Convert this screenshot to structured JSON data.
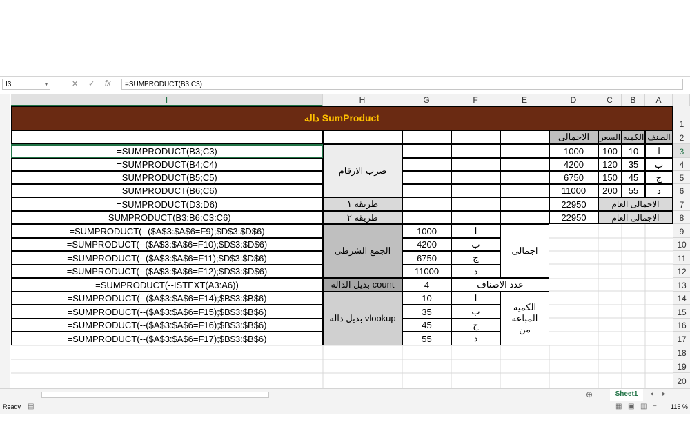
{
  "formula_bar": {
    "name_box": "I3",
    "formula": "=SUMPRODUCT(B3;C3)",
    "cancel": "✕",
    "enter": "✓",
    "fx": "fx"
  },
  "columns": [
    "I",
    "H",
    "G",
    "F",
    "E",
    "D",
    "C",
    "B",
    "A"
  ],
  "rows": [
    "1",
    "2",
    "3",
    "4",
    "5",
    "6",
    "7",
    "8",
    "9",
    "10",
    "11",
    "12",
    "13",
    "14",
    "15",
    "16",
    "17",
    "18",
    "19",
    "20"
  ],
  "title": "داله SumProduct",
  "table": {
    "headers": {
      "item": "الصنف",
      "qty": "الكميه",
      "price": "السعر",
      "total": "الاجمالى"
    },
    "rows": [
      {
        "item": "ا",
        "qty": "10",
        "price": "100",
        "total": "1000"
      },
      {
        "item": "ب",
        "qty": "35",
        "price": "120",
        "total": "4200"
      },
      {
        "item": "ج",
        "qty": "45",
        "price": "150",
        "total": "6750"
      },
      {
        "item": "د",
        "qty": "55",
        "price": "200",
        "total": "11000"
      }
    ],
    "grand_label": "الاجمالى العام",
    "grand_1": "22950",
    "grand_2": "22950"
  },
  "formulas": {
    "r3": "=SUMPRODUCT(B3;C3)",
    "r4": "=SUMPRODUCT(B4;C4)",
    "r5": "=SUMPRODUCT(B5;C5)",
    "r6": "=SUMPRODUCT(B6;C6)",
    "r7": "=SUMPRODUCT(D3:D6)",
    "r8": "=SUMPRODUCT(B3:B6;C3:C6)",
    "r9": "=SUMPRODUCT(--($A$3:$A$6=F9);$D$3:$D$6)",
    "r10": "=SUMPRODUCT(--($A$3:$A$6=F10);$D$3:$D$6)",
    "r11": "=SUMPRODUCT(--($A$3:$A$6=F11);$D$3:$D$6)",
    "r12": "=SUMPRODUCT(--($A$3:$A$6=F12);$D$3:$D$6)",
    "r13": "=SUMPRODUCT(--ISTEXT(A3:A6))",
    "r14": "=SUMPRODUCT(--($A$3:$A$6=F14);$B$3:$B$6)",
    "r15": "=SUMPRODUCT(--($A$3:$A$6=F15);$B$3:$B$6)",
    "r16": "=SUMPRODUCT(--($A$3:$A$6=F16);$B$3:$B$6)",
    "r17": "=SUMPRODUCT(--($A$3:$A$6=F17);$B$3:$B$6)"
  },
  "labels": {
    "multiply": "ضرب الارقام",
    "method1": "طريقه ١",
    "method2": "طريقه ٢",
    "conditional_sum": "الجمع الشرطى",
    "total": "اجمالى",
    "count_alt": "بديل الداله count",
    "item_count": "عدد الاصناف",
    "vlookup_alt": "بديل داله vlookup",
    "qty_sold": "الكميه المباعه من"
  },
  "cond_section": {
    "items": [
      "ا",
      "ب",
      "ج",
      "د"
    ],
    "values": [
      "1000",
      "4200",
      "6750",
      "11000"
    ],
    "count_value": "4",
    "qty_values": [
      "10",
      "35",
      "45",
      "55"
    ]
  },
  "sheet_tab": "Sheet1",
  "status": {
    "ready": "Ready",
    "zoom": "115 %"
  }
}
